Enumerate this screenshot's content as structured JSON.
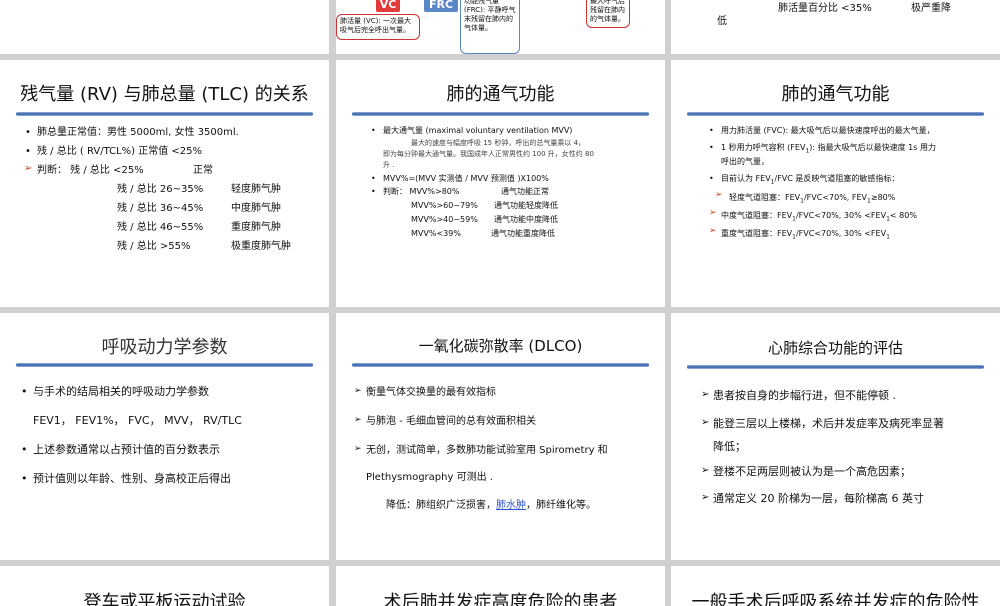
{
  "s0": {},
  "s1": {
    "vc_label": "VC",
    "frc_label": "FRC",
    "vc_note": "肺活量 (VC): 一次最大吸气后完全呼出气量。",
    "frc_note": "功能残气量 (FRC): 平静呼气末残留在肺内的气体量。",
    "rv_note": "最大呼气后残留在肺内的气体量。"
  },
  "s2": {
    "line1": "肺活量百分比 <35%",
    "line1b": "极严重降",
    "line2": "低"
  },
  "s3": {
    "title": "残气量 (RV) 与肺总量 (TLC) 的关系",
    "l1": "肺总量正常值：男性 5000ml, 女性 3500ml.",
    "l2": "残 / 总比 ( RV/TCL%) 正常值 <25%",
    "l3": "判断：  残 / 总比 <25%",
    "l3b": "正常",
    "rows": [
      {
        "k": "残 / 总比 26~35%",
        "v": "轻度肺气肿"
      },
      {
        "k": "残 / 总比 36~45%",
        "v": "中度肺气肿"
      },
      {
        "k": "残 / 总比 46~55%",
        "v": "重度肺气肿"
      },
      {
        "k": "残 / 总比 >55%",
        "v": "极重度肺气肿"
      }
    ]
  },
  "s4": {
    "title": "肺的通气功能",
    "l1": "最大通气量 (maximal voluntary ventilation MVV)",
    "l2": "最大的速度与幅度呼吸 15 秒钟，呼出的总气量乘以 4，",
    "l3": "即为每分钟最大通气量。我国成年人正常男性约 100 升，女性约 80",
    "l4": "升 .",
    "l5": "MVV%=(MVV 实测值 / MVV 预测值 )X100%",
    "l6a": "判断：   MVV%>80%",
    "l6b": "通气功能正常",
    "rows": [
      {
        "k": "MVV%>60~79%",
        "v": "通气功能轻度降低"
      },
      {
        "k": "MVV%>40~59%",
        "v": "通气功能中度降低"
      },
      {
        "k": "MVV%<39%",
        "v": "通气功能重度降低"
      }
    ]
  },
  "s5": {
    "title": "肺的通气功能",
    "l1": "用力肺活量 (FVC): 最大吸气后以最快速度呼出的最大气量，",
    "l2": "1 秒用力呼气容积 (FEV",
    "l2b": "): 指最大吸气后以最快速度 1s 用力",
    "l3": "呼出的气量，",
    "l4": "目前认为 FEV",
    "l4b": "/FVC 是反映气道阻塞的敏感指标：",
    "l5": "轻度气道阻塞：FEV",
    "l5b": "/FVC<70%,  FEV",
    "l5c": "≥80%",
    "l6": "中度气道阻塞：FEV",
    "l6b": "/FVC<70%,  30% <FEV",
    "l6c": "< 80%",
    "l7": "重度气道阻塞：FEV",
    "l7b": "/FVC<70%,  30% <FEV",
    "sub1": "1"
  },
  "s6": {
    "title": "呼吸动力学参数",
    "l1": "与手术的结局相关的呼吸动力学参数",
    "l2": "FEV1，  FEV1%，  FVC，  MVV，  RV/TLC",
    "l3": "上述参数通常以占预计值的百分数表示",
    "l4": "预计值则以年龄、性别、身高校正后得出"
  },
  "s7": {
    "title": "一氧化碳弥散率 (DLCO)",
    "l1": "衡量气体交换量的最有效指标",
    "l2": "与肺泡 - 毛细血管间的总有效面积相关",
    "l3": "无创，测试简单，多数肺功能试验室用 Spirometry 和",
    "l4": "Plethysmography 可测出 .",
    "l5a": "降低：肺组织广泛损害，",
    "l5link": "肺水肿",
    "l5b": "，肺纤维化等。"
  },
  "s8": {
    "title": "心肺综合功能的评估",
    "l1": "患者按自身的步幅行进，但不能停顿 .",
    "l2": "能登三层以上楼梯，术后并发症率及病死率显著",
    "l2b": "降低；",
    "l3": "登楼不足两层则被认为是一个高危因素；",
    "l4": "通常定义 20 阶梯为一层，每阶梯高 6 英寸"
  },
  "s9": {
    "title": "登车或平板运动试验"
  },
  "s10": {
    "title": "术后肺并发症高度危险的患者"
  },
  "s11": {
    "title": "一般手术后呼吸系统并发症的危险性"
  }
}
